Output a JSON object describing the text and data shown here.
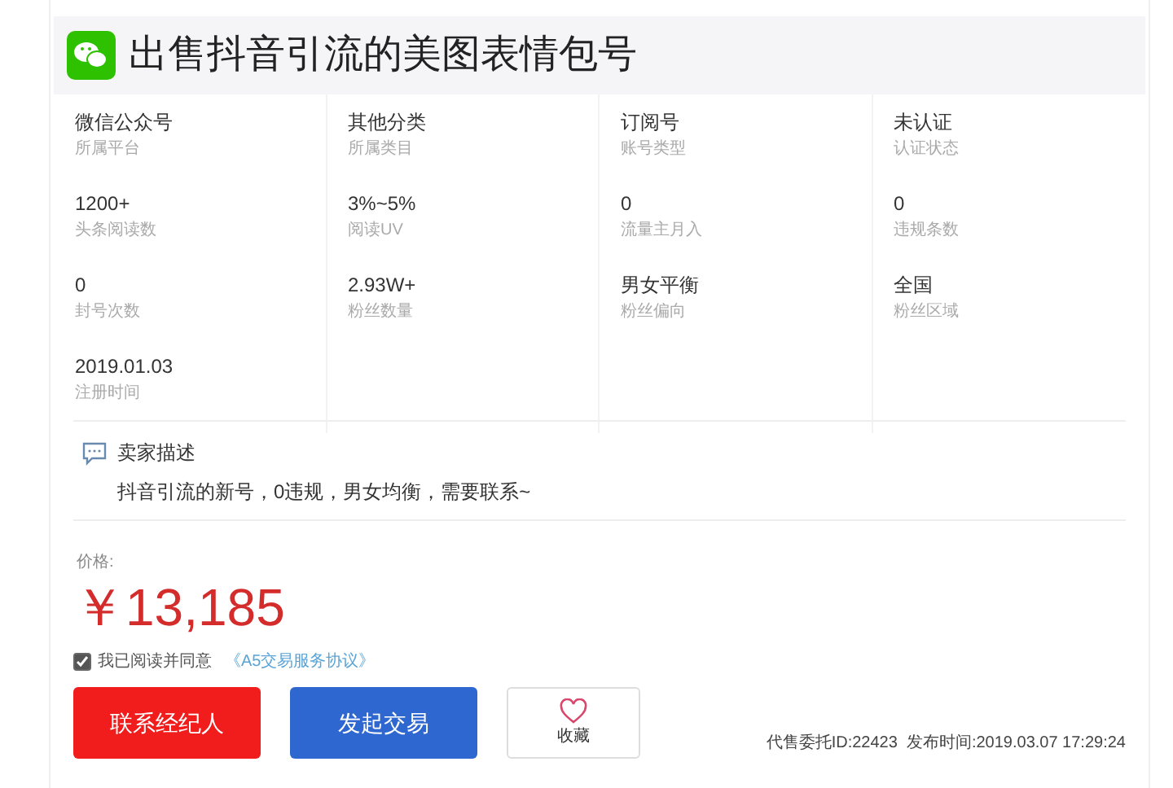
{
  "title": "出售抖音引流的美图表情包号",
  "columns": [
    [
      {
        "value": "微信公众号",
        "label": "所属平台"
      },
      {
        "value": "1200+",
        "label": "头条阅读数"
      },
      {
        "value": "0",
        "label": "封号次数"
      },
      {
        "value": "2019.01.03",
        "label": "注册时间"
      }
    ],
    [
      {
        "value": "其他分类",
        "label": "所属类目"
      },
      {
        "value": "3%~5%",
        "label": "阅读UV"
      },
      {
        "value": "2.93W+",
        "label": "粉丝数量"
      }
    ],
    [
      {
        "value": "订阅号",
        "label": "账号类型"
      },
      {
        "value": "0",
        "label": "流量主月入"
      },
      {
        "value": "男女平衡",
        "label": "粉丝偏向"
      }
    ],
    [
      {
        "value": "未认证",
        "label": "认证状态"
      },
      {
        "value": "0",
        "label": "违规条数"
      },
      {
        "value": "全国",
        "label": "粉丝区域"
      }
    ]
  ],
  "description": {
    "heading": "卖家描述",
    "text": "抖音引流的新号，0违规，男女均衡，需要联系~"
  },
  "price": {
    "label": "价格:",
    "value": "￥13,185"
  },
  "agreement": {
    "checked": true,
    "text": "我已阅读并同意",
    "link": "《A5交易服务协议》"
  },
  "buttons": {
    "contact": "联系经纪人",
    "trade": "发起交易",
    "favorite": "收藏"
  },
  "footer": "代售委托ID:22423  发布时间:2019.03.07 17:29:24"
}
